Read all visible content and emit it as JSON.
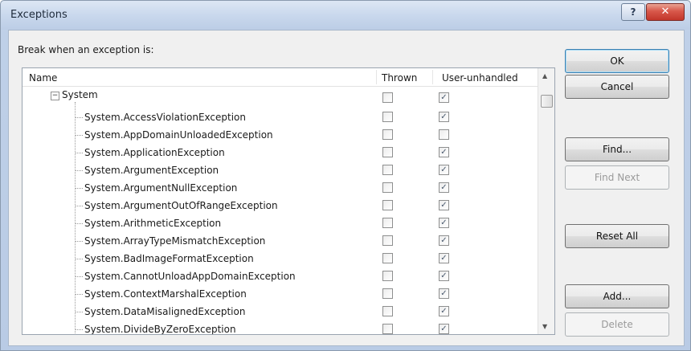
{
  "window": {
    "title": "Exceptions",
    "help_glyph": "?",
    "close_glyph": "✕"
  },
  "break_label": "Break when an exception is:",
  "columns": {
    "name": "Name",
    "thrown": "Thrown",
    "user_unhandled": "User-unhandled"
  },
  "tree": {
    "root": {
      "label": "System",
      "expander": "−",
      "thrown": false,
      "user_unhandled": true
    },
    "items": [
      {
        "label": "System.AccessViolationException",
        "thrown": false,
        "user_unhandled": true
      },
      {
        "label": "System.AppDomainUnloadedException",
        "thrown": false,
        "user_unhandled": false
      },
      {
        "label": "System.ApplicationException",
        "thrown": false,
        "user_unhandled": true
      },
      {
        "label": "System.ArgumentException",
        "thrown": false,
        "user_unhandled": true
      },
      {
        "label": "System.ArgumentNullException",
        "thrown": false,
        "user_unhandled": true
      },
      {
        "label": "System.ArgumentOutOfRangeException",
        "thrown": false,
        "user_unhandled": true
      },
      {
        "label": "System.ArithmeticException",
        "thrown": false,
        "user_unhandled": true
      },
      {
        "label": "System.ArrayTypeMismatchException",
        "thrown": false,
        "user_unhandled": true
      },
      {
        "label": "System.BadImageFormatException",
        "thrown": false,
        "user_unhandled": true
      },
      {
        "label": "System.CannotUnloadAppDomainException",
        "thrown": false,
        "user_unhandled": true
      },
      {
        "label": "System.ContextMarshalException",
        "thrown": false,
        "user_unhandled": true
      },
      {
        "label": "System.DataMisalignedException",
        "thrown": false,
        "user_unhandled": true
      },
      {
        "label": "System.DivideByZeroException",
        "thrown": false,
        "user_unhandled": true
      }
    ]
  },
  "buttons": {
    "ok": "OK",
    "cancel": "Cancel",
    "find": "Find...",
    "find_next": "Find Next",
    "reset_all": "Reset All",
    "add": "Add...",
    "delete": "Delete"
  },
  "scrollbar": {
    "up": "▲",
    "down": "▼"
  },
  "check_glyph": "✓"
}
